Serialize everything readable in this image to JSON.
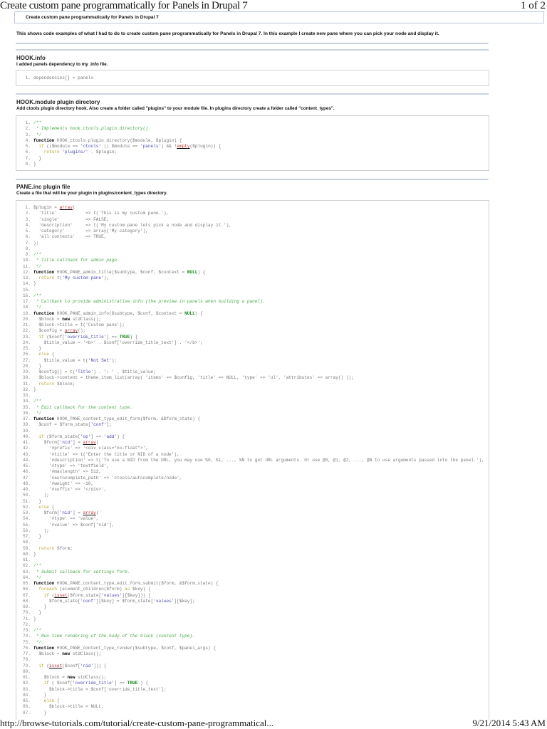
{
  "header": {
    "title": "Create custom pane programmatically for Panels in Drupal 7",
    "page": "1 of 2"
  },
  "article": {
    "title": "Create custom pane programmatically for Panels in Drupal 7",
    "intro": "This shows code examples of what I had to do to create custom pane programmatically for Panels in Drupal 7. In this example I create new pane where you can pick your node and display it."
  },
  "sections": [
    {
      "heading": "HOOK.info",
      "sub": "I added panels dependency to my .info file.",
      "code": [
        "dependencies[] = panels"
      ]
    },
    {
      "heading": "HOOK.module plugin directory",
      "sub": "Add ctools plugin directory hook. Also create a folder called \"plugins\" to your module file. In plugins directory create a folder called \"content_types\".",
      "code": [
        "/**",
        " * Implements hook_ctools_plugin_directory().",
        " */",
        "function HOOK_ctools_plugin_directory($module, $plugin) {",
        "  if (($module == 'ctools' || $module == 'panels') && !empty($plugin)) {",
        "    return 'plugins/' . $plugin;",
        "  }",
        "}"
      ]
    },
    {
      "heading": "PANE.inc plugin file",
      "sub": "Create a file that will be your plugin in plugins/content_types directory.",
      "code": [
        "$plugin = array(",
        "  'title'           => t('This is my custom pane.'),",
        "  'single'          => FALSE,",
        "  'description'     => t('My custom pane lets pick a node and display it.'),",
        "  'category'        => array('My category'),",
        "  'all contexts'    => TRUE,",
        ");",
        "",
        "/**",
        " * Title callback for admin page.",
        " */",
        "function HOOK_PANE_admin_title($subtype, $conf, $context = NULL) {",
        "  return t('My custom pane');",
        "}",
        "",
        "/**",
        " * Callback to provide administrative info (the preview in panels when building a panel).",
        " */",
        "function HOOK_PANE_admin_info($subtype, $conf, $context = NULL) {",
        "  $block = new stdClass();",
        "  $block->title = t('Custom pane');",
        "  $config = array();",
        "  if ($conf['override_title'] == TRUE) {",
        "    $title_value = '<b>' . $conf['override_title_text'] . '</b>';",
        "  }",
        "  else {",
        "    $title_value = t('Not Set');",
        "  }",
        "  $config[] = t('Title') . ': ' . $title_value;",
        "  $block->content = theme_item_list(array( 'items' => $config, 'title' => NULL, 'type' => 'ul', 'attributes' => array() ));",
        "  return $block;",
        "}",
        "",
        "/**",
        " * Edit callback for the content type.",
        " */",
        "function HOOK_PANE_content_type_edit_form($form, &$form_state) {",
        "  $conf = $form_state['conf'];",
        "",
        "  if ($form_state['op'] == 'add') {",
        "    $form['nid'] = array(",
        "      '#prefix' => '<div class=\"no-float\">',",
        "      '#title' => t('Enter the title or NID of a node'),",
        "      '#description' => t('To use a NID from the URL, you may use %0, %1, ..., %N to get URL arguments. Or use @0, @1, @2, ..., @N to use arguments passed into the panel.'),",
        "      '#type' => 'textfield',",
        "      '#maxlength' => 512,",
        "      '#autocomplete_path' => 'ctools/autocomplete/node',",
        "      '#weight' => -10,",
        "      '#suffix' => '</div>',",
        "    );",
        "  }",
        "  else {",
        "    $form['nid'] = array(",
        "      '#type' => 'value',",
        "      '#value' => $conf['nid'],",
        "    );",
        "  }",
        "",
        "  return $form;",
        "}",
        "",
        "/**",
        " * Submit callback for settings form.",
        " */",
        "function HOOK_PANE_content_type_edit_form_submit($form, &$form_state) {",
        "  foreach (element_children($form) as $key) {",
        "    if (isset($form_state['values'][$key])) {",
        "      $form_state['conf'][$key] = $form_state['values'][$key];",
        "    }",
        "  }",
        "}",
        "",
        "/**",
        " * Run-time rendering of the body of the block (content type).",
        " */",
        "function HOOK_PANE_content_type_render($subtype, $conf, $panel_args) {",
        "  $block = new stdClass();",
        "",
        "  if (isset($conf['nid'])) {",
        "",
        "    $block = new stdClass();",
        "    if ( $conf['override_title'] == TRUE ) {",
        "      $block->title = $conf['override_title_text'];",
        "    }",
        "    else {",
        "      $block->title = NULL;",
        "    }"
      ]
    }
  ],
  "footer": {
    "url": "http://browse-tutorials.com/tutorial/create-custom-pane-programmatical...",
    "datetime": "9/21/2014 5:43 AM"
  }
}
